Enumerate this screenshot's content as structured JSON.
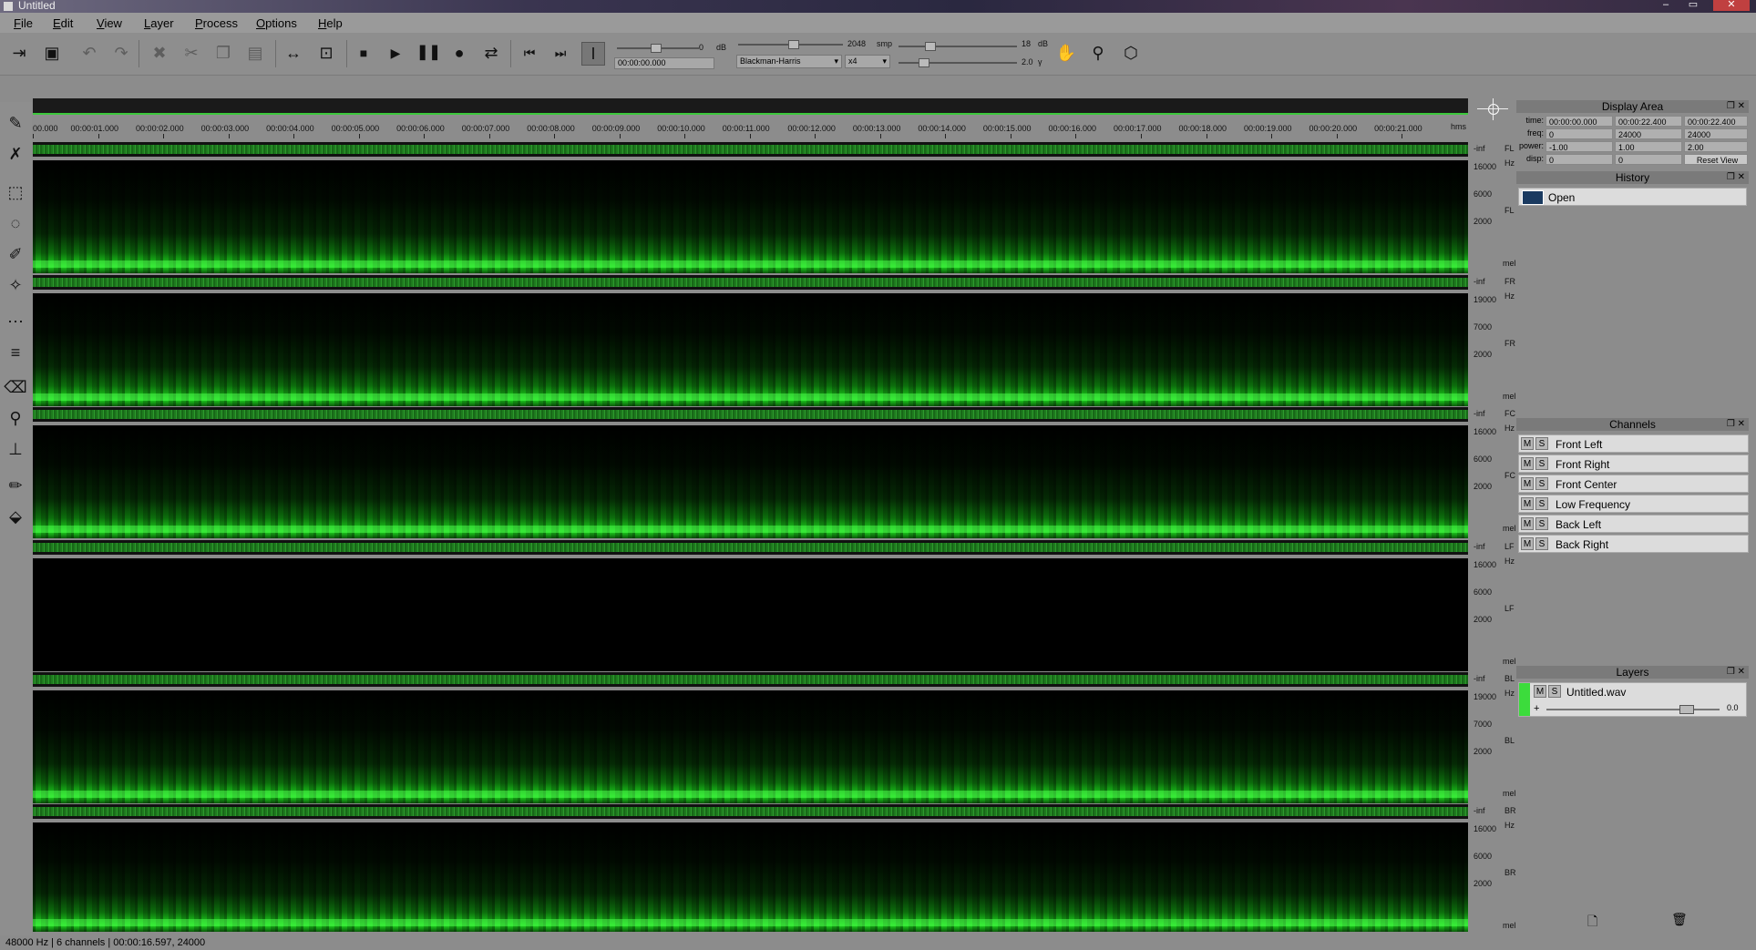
{
  "window": {
    "title": "Untitled",
    "buttons": [
      "–",
      "▭",
      "✕"
    ]
  },
  "menu": [
    {
      "label": "File",
      "u": "F",
      "rest": "ile"
    },
    {
      "label": "Edit",
      "u": "E",
      "rest": "dit"
    },
    {
      "label": "View",
      "u": "V",
      "rest": "iew"
    },
    {
      "label": "Layer",
      "u": "L",
      "rest": "ayer"
    },
    {
      "label": "Process",
      "u": "P",
      "rest": "rocess"
    },
    {
      "label": "Options",
      "u": "O",
      "rest": "ptions"
    },
    {
      "label": "Help",
      "u": "H",
      "rest": "elp"
    }
  ],
  "toolbar": {
    "volume_db": "0",
    "db_unit": "dB",
    "position": "00:00:00.000",
    "fft_size": "2048",
    "fft_unit": "smp",
    "window_fn": "Blackman-Harris",
    "overlap": "x4",
    "range_db": "18",
    "range_unit": "dB",
    "gamma": "2.0",
    "gamma_unit": "γ"
  },
  "ruler": {
    "unit": "hms",
    "ticks": [
      "00.000",
      "00:00:01.000",
      "00:00:02.000",
      "00:00:03.000",
      "00:00:04.000",
      "00:00:05.000",
      "00:00:06.000",
      "00:00:07.000",
      "00:00:08.000",
      "00:00:09.000",
      "00:00:10.000",
      "00:00:11.000",
      "00:00:12.000",
      "00:00:13.000",
      "00:00:14.000",
      "00:00:15.000",
      "00:00:16.000",
      "00:00:17.000",
      "00:00:18.000",
      "00:00:19.000",
      "00:00:20.000",
      "00:00:21.000"
    ]
  },
  "tracks": [
    {
      "tag": "FL",
      "freqs": [
        "16000",
        "6000",
        "2000"
      ],
      "hz": "Hz",
      "mel": "mel",
      "inf": "-inf",
      "empty": false
    },
    {
      "tag": "FR",
      "freqs": [
        "19000",
        "7000",
        "2000"
      ],
      "hz": "Hz",
      "mel": "mel",
      "inf": "-inf",
      "empty": false
    },
    {
      "tag": "FC",
      "freqs": [
        "16000",
        "6000",
        "2000"
      ],
      "hz": "Hz",
      "mel": "mel",
      "inf": "-inf",
      "empty": false
    },
    {
      "tag": "LF",
      "freqs": [
        "16000",
        "6000",
        "2000"
      ],
      "hz": "Hz",
      "mel": "mel",
      "inf": "-inf",
      "empty": true
    },
    {
      "tag": "BL",
      "freqs": [
        "19000",
        "7000",
        "2000"
      ],
      "hz": "Hz",
      "mel": "mel",
      "inf": "-inf",
      "empty": false
    },
    {
      "tag": "BR",
      "freqs": [
        "16000",
        "6000",
        "2000"
      ],
      "hz": "Hz",
      "mel": "mel",
      "inf": "-inf",
      "empty": false
    }
  ],
  "display_area": {
    "title": "Display Area",
    "rows": [
      {
        "label": "time:",
        "values": [
          "00:00:00.000",
          "00:00:22.400",
          "00:00:22.400"
        ]
      },
      {
        "label": "freq:",
        "values": [
          "0",
          "24000",
          "24000"
        ]
      },
      {
        "label": "power:",
        "values": [
          "-1.00",
          "1.00",
          "2.00"
        ]
      },
      {
        "label": "disp:",
        "values": [
          "0",
          "0"
        ]
      }
    ],
    "reset_label": "Reset View"
  },
  "history": {
    "title": "History",
    "items": [
      "Open"
    ]
  },
  "channels": {
    "title": "Channels",
    "m": "M",
    "s": "S",
    "items": [
      "Front Left",
      "Front Right",
      "Front Center",
      "Low Frequency",
      "Back Left",
      "Back Right"
    ]
  },
  "layers": {
    "title": "Layers",
    "m": "M",
    "s": "S",
    "items": [
      {
        "name": "Untitled.wav",
        "gain": "0.0"
      }
    ],
    "add": "+"
  },
  "status": "48000 Hz | 6 channels | 00:00:16.597, 24000",
  "colors": {
    "accent": "#3cc83c",
    "spectrum_peak": "#1ed81e"
  }
}
